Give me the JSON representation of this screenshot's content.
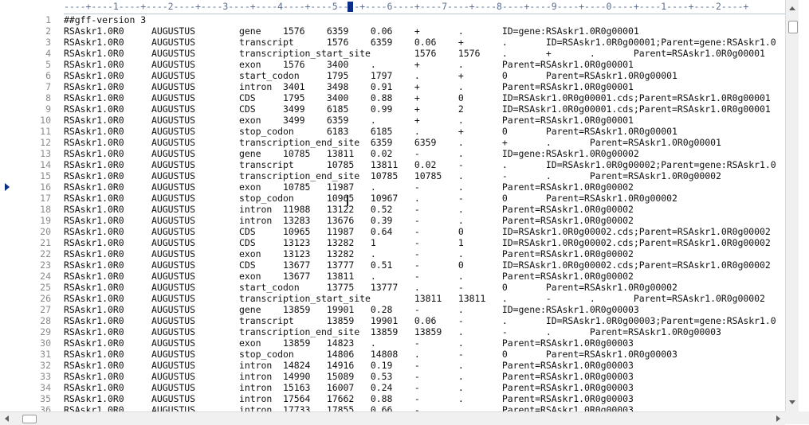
{
  "ruler": {
    "text": "----+----1----+----2----+----3----+----4----+----5----+----6----+----7----+----8----+----9----+----0----+----1----+----2----+"
  },
  "lines": [
    {
      "n": "1",
      "text": "##gff-version 3"
    },
    {
      "n": "2",
      "text": "RSAskr1.0R0     AUGUSTUS        gene    1576    6359    0.06    +       .       ID=gene:RSAskr1.0R0g00001"
    },
    {
      "n": "3",
      "text": "RSAskr1.0R0     AUGUSTUS        transcript      1576    6359    0.06    +       .       ID=RSAskr1.0R0g00001;Parent=gene:RSAskr1.0"
    },
    {
      "n": "4",
      "text": "RSAskr1.0R0     AUGUSTUS        transcription_start_site        1576    1576    .       +       .       Parent=RSAskr1.0R0g00001"
    },
    {
      "n": "5",
      "text": "RSAskr1.0R0     AUGUSTUS        exon    1576    3400    .       +       .       Parent=RSAskr1.0R0g00001"
    },
    {
      "n": "6",
      "text": "RSAskr1.0R0     AUGUSTUS        start_codon     1795    1797    .       +       0       Parent=RSAskr1.0R0g00001"
    },
    {
      "n": "7",
      "text": "RSAskr1.0R0     AUGUSTUS        intron  3401    3498    0.91    +       .       Parent=RSAskr1.0R0g00001"
    },
    {
      "n": "8",
      "text": "RSAskr1.0R0     AUGUSTUS        CDS     1795    3400    0.88    +       0       ID=RSAskr1.0R0g00001.cds;Parent=RSAskr1.0R0g00001"
    },
    {
      "n": "9",
      "text": "RSAskr1.0R0     AUGUSTUS        CDS     3499    6185    0.99    +       2       ID=RSAskr1.0R0g00001.cds;Parent=RSAskr1.0R0g00001"
    },
    {
      "n": "10",
      "text": "RSAskr1.0R0     AUGUSTUS        exon    3499    6359    .       +       .       Parent=RSAskr1.0R0g00001"
    },
    {
      "n": "11",
      "text": "RSAskr1.0R0     AUGUSTUS        stop_codon      6183    6185    .       +       0       Parent=RSAskr1.0R0g00001"
    },
    {
      "n": "12",
      "text": "RSAskr1.0R0     AUGUSTUS        transcription_end_site  6359    6359    .       +       .       Parent=RSAskr1.0R0g00001"
    },
    {
      "n": "13",
      "text": "RSAskr1.0R0     AUGUSTUS        gene    10785   13811   0.02    -       .       ID=gene:RSAskr1.0R0g00002"
    },
    {
      "n": "14",
      "text": "RSAskr1.0R0     AUGUSTUS        transcript      10785   13811   0.02    -       .       ID=RSAskr1.0R0g00002;Parent=gene:RSAskr1.0"
    },
    {
      "n": "15",
      "text": "RSAskr1.0R0     AUGUSTUS        transcription_end_site  10785   10785   .       -       .       Parent=RSAskr1.0R0g00002"
    },
    {
      "n": "16",
      "text": "RSAskr1.0R0     AUGUSTUS        exon    10785   11987   .       -       .       Parent=RSAskr1.0R0g00002"
    },
    {
      "n": "17",
      "text": "RSAskr1.0R0     AUGUSTUS        stop_codon      10965   10967   .       -       0       Parent=RSAskr1.0R0g00002"
    },
    {
      "n": "18",
      "text": "RSAskr1.0R0     AUGUSTUS        intron  11988   13122   0.52    -       .       Parent=RSAskr1.0R0g00002"
    },
    {
      "n": "19",
      "text": "RSAskr1.0R0     AUGUSTUS        intron  13283   13676   0.39    -       .       Parent=RSAskr1.0R0g00002"
    },
    {
      "n": "20",
      "text": "RSAskr1.0R0     AUGUSTUS        CDS     10965   11987   0.64    -       0       ID=RSAskr1.0R0g00002.cds;Parent=RSAskr1.0R0g00002"
    },
    {
      "n": "21",
      "text": "RSAskr1.0R0     AUGUSTUS        CDS     13123   13282   1       -       1       ID=RSAskr1.0R0g00002.cds;Parent=RSAskr1.0R0g00002"
    },
    {
      "n": "22",
      "text": "RSAskr1.0R0     AUGUSTUS        exon    13123   13282   .       -       .       Parent=RSAskr1.0R0g00002"
    },
    {
      "n": "23",
      "text": "RSAskr1.0R0     AUGUSTUS        CDS     13677   13777   0.51    -       0       ID=RSAskr1.0R0g00002.cds;Parent=RSAskr1.0R0g00002"
    },
    {
      "n": "24",
      "text": "RSAskr1.0R0     AUGUSTUS        exon    13677   13811   .       -       .       Parent=RSAskr1.0R0g00002"
    },
    {
      "n": "25",
      "text": "RSAskr1.0R0     AUGUSTUS        start_codon     13775   13777   .       -       0       Parent=RSAskr1.0R0g00002"
    },
    {
      "n": "26",
      "text": "RSAskr1.0R0     AUGUSTUS        transcription_start_site        13811   13811   .       -       .       Parent=RSAskr1.0R0g00002"
    },
    {
      "n": "27",
      "text": "RSAskr1.0R0     AUGUSTUS        gene    13859   19901   0.28    -       .       ID=gene:RSAskr1.0R0g00003"
    },
    {
      "n": "28",
      "text": "RSAskr1.0R0     AUGUSTUS        transcript      13859   19901   0.06    -       .       ID=RSAskr1.0R0g00003;Parent=gene:RSAskr1.0"
    },
    {
      "n": "29",
      "text": "RSAskr1.0R0     AUGUSTUS        transcription_end_site  13859   13859   .       -       .       Parent=RSAskr1.0R0g00003"
    },
    {
      "n": "30",
      "text": "RSAskr1.0R0     AUGUSTUS        exon    13859   14823   .       -       .       Parent=RSAskr1.0R0g00003"
    },
    {
      "n": "31",
      "text": "RSAskr1.0R0     AUGUSTUS        stop_codon      14806   14808   .       -       0       Parent=RSAskr1.0R0g00003"
    },
    {
      "n": "32",
      "text": "RSAskr1.0R0     AUGUSTUS        intron  14824   14916   0.19    -       .       Parent=RSAskr1.0R0g00003"
    },
    {
      "n": "33",
      "text": "RSAskr1.0R0     AUGUSTUS        intron  14990   15089   0.53    -       .       Parent=RSAskr1.0R0g00003"
    },
    {
      "n": "34",
      "text": "RSAskr1.0R0     AUGUSTUS        intron  15163   16007   0.24    -       .       Parent=RSAskr1.0R0g00003"
    },
    {
      "n": "35",
      "text": "RSAskr1.0R0     AUGUSTUS        intron  17564   17662   0.88    -       .       Parent=RSAskr1.0R0g00003"
    },
    {
      "n": "36",
      "text": "RSAskr1.0R0     AUGUSTUS        intron  17733   17855   0.66    -       .       Parent=RSAskr1.0R0g00003"
    }
  ]
}
